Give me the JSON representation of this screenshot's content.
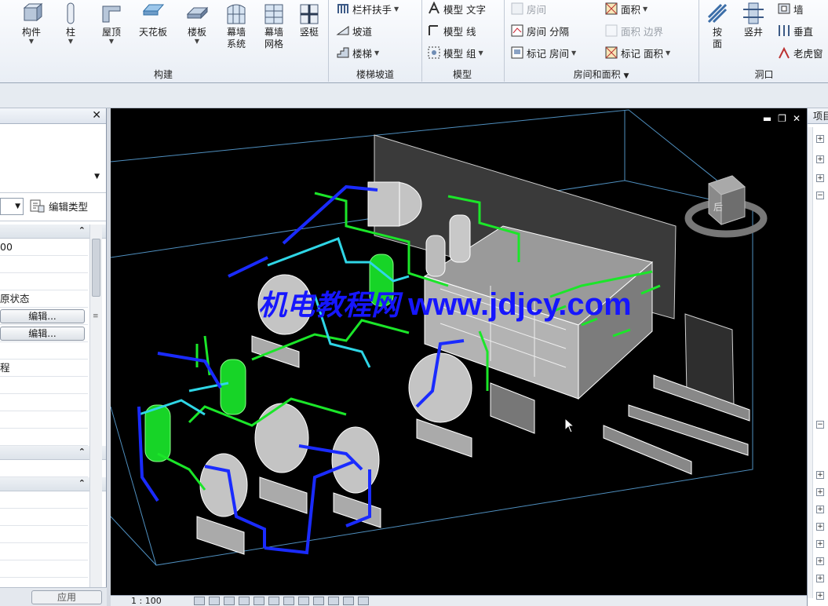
{
  "ribbon": {
    "panels": {
      "build": "构建",
      "stairs": "楼梯坡道",
      "model": "模型",
      "room_area": "房间和面积",
      "opening": "洞口"
    },
    "build": {
      "component": "构件",
      "column": "柱",
      "roof": "屋顶",
      "ceiling": "天花板",
      "floor": "楼板",
      "curtain_system": [
        "幕墙",
        "系统"
      ],
      "curtain_grid": [
        "幕墙",
        "网格"
      ],
      "mullion": "竖梃"
    },
    "stairs": {
      "railing": "栏杆扶手",
      "ramp": "坡道",
      "stair": "楼梯"
    },
    "model": {
      "model_text": "模型 文字",
      "model_line": "模型 线",
      "model_group": "模型 组"
    },
    "room_area": {
      "room_top": "房间",
      "room": "房间",
      "separator": "分隔",
      "tag": "标记",
      "room2": "房间",
      "area": "面积",
      "area_boundary_1": "面积",
      "area_boundary_2": "边界",
      "tag2": "标记",
      "area2": "面积"
    },
    "opening": {
      "by_face": [
        "按",
        "面"
      ],
      "shaft": "竖井",
      "wall": "墙",
      "vertical": "垂直",
      "dormer": "老虎窗"
    }
  },
  "properties": {
    "edit_type": "编辑类型",
    "value_1": "00",
    "label_state": "原状态",
    "edit_btn_1": "编辑...",
    "edit_btn_2": "编辑...",
    "label_process": "程",
    "apply": "应用"
  },
  "viewport": {
    "watermark_cn": "机电教程网",
    "watermark_url": "www.jdjcy.com",
    "viewcube_label": "后"
  },
  "status": {
    "scale": "1 : 100"
  },
  "browser": {
    "title": "项目浏览器"
  }
}
